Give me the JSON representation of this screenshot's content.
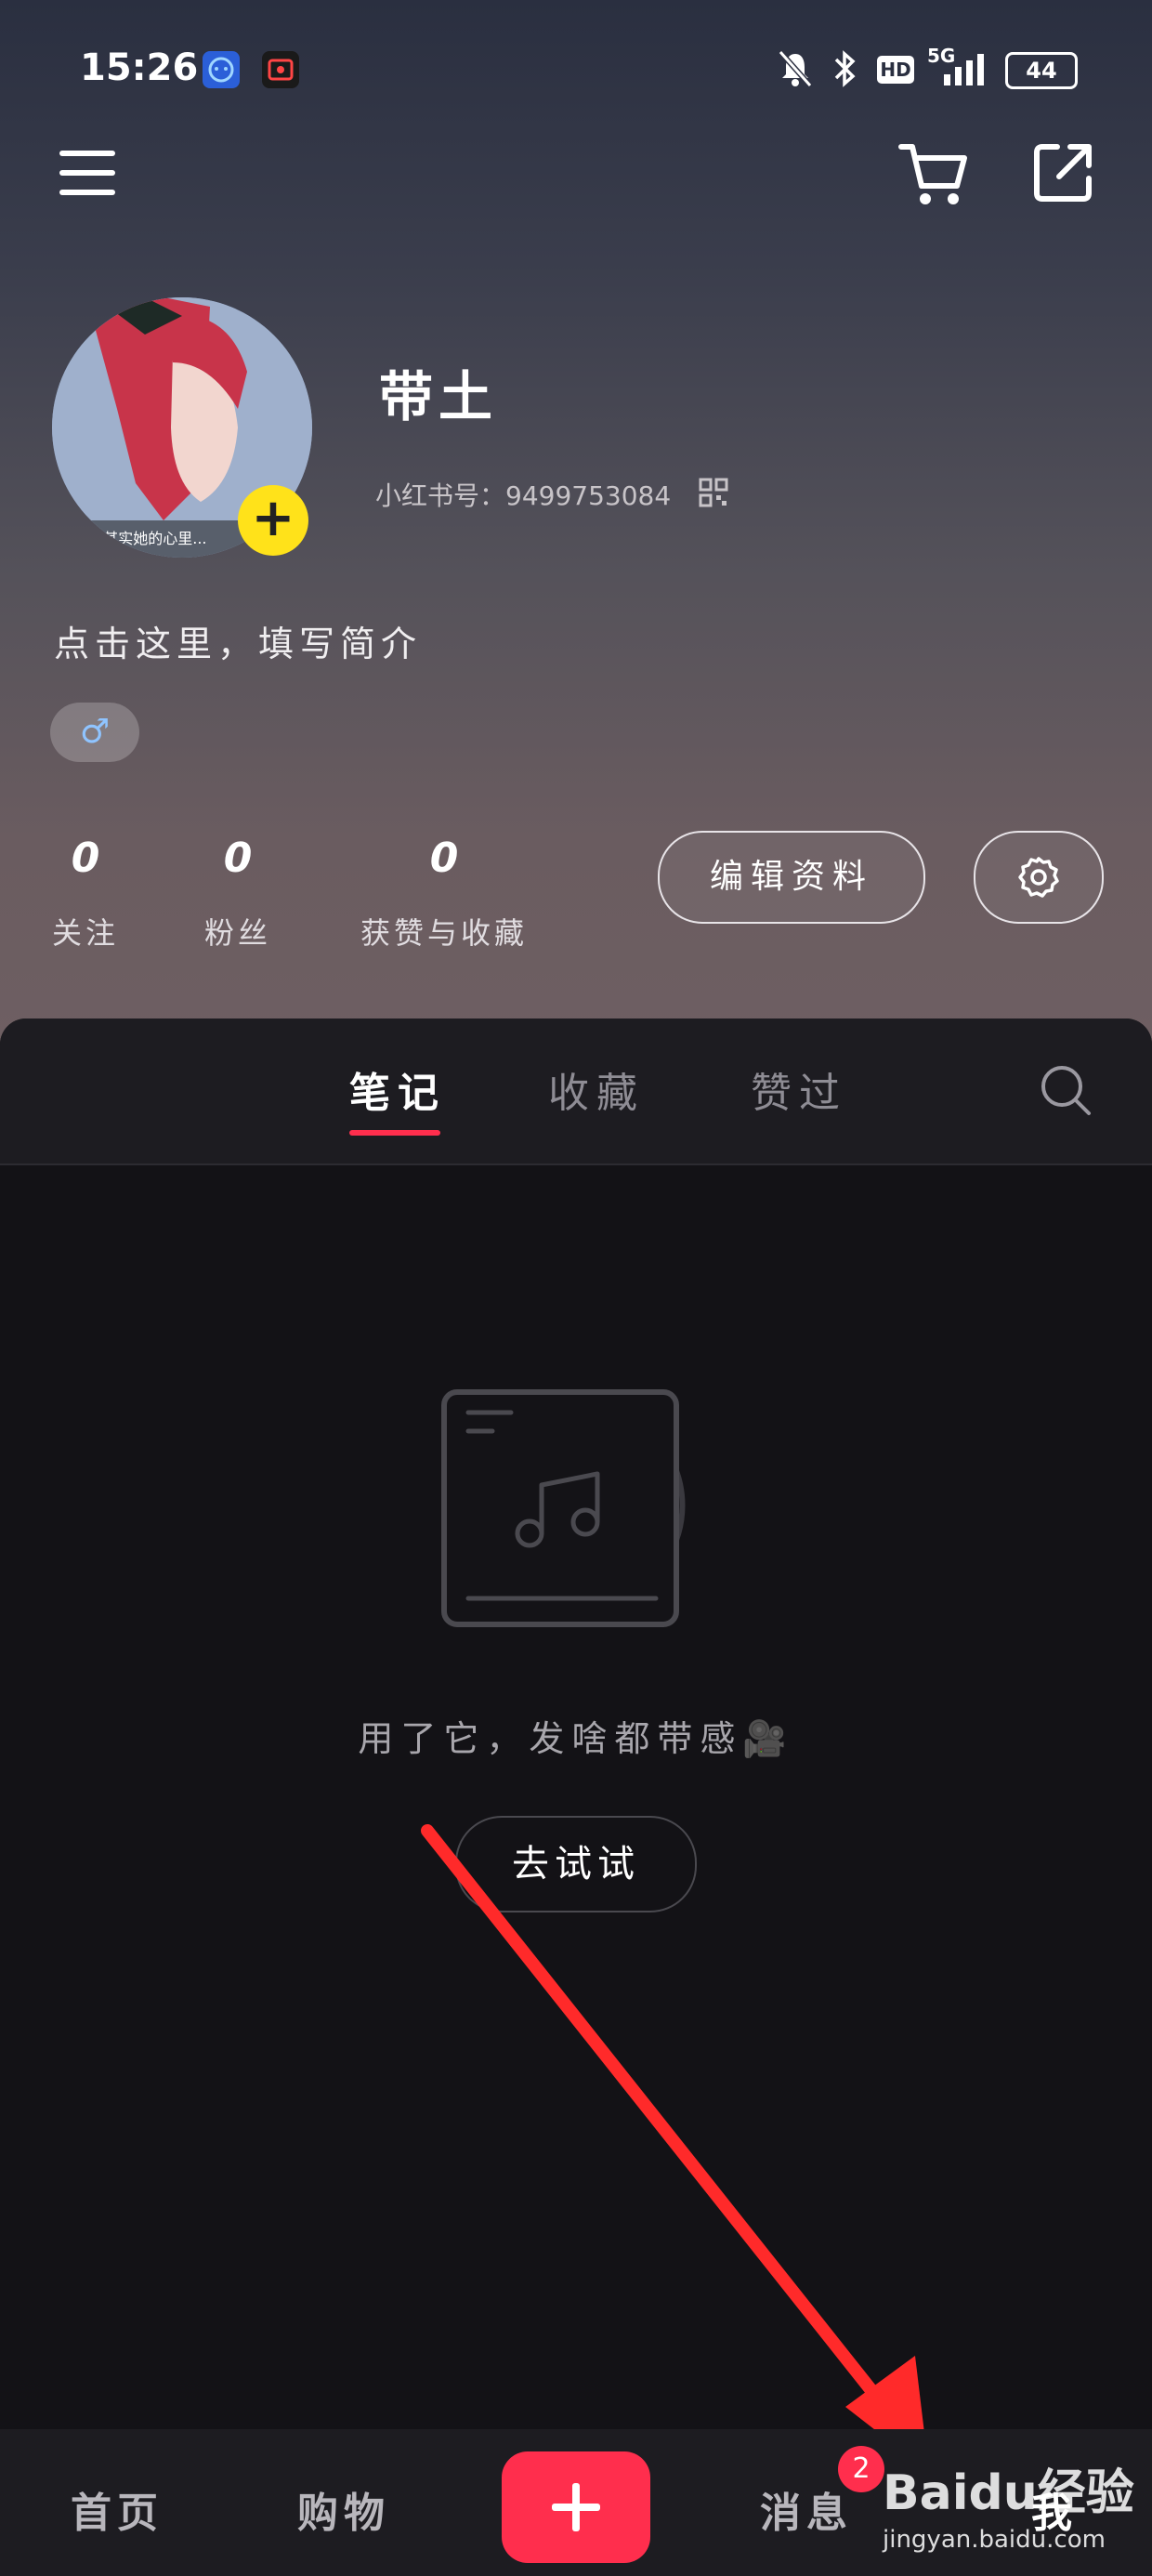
{
  "status_bar": {
    "time": "15:26",
    "network": "5G",
    "hd": "HD",
    "battery": "44"
  },
  "header": {
    "menu_icon": "hamburger-menu-icon",
    "cart_icon": "shopping-cart-icon",
    "share_icon": "share-external-icon"
  },
  "profile": {
    "username": "带土",
    "user_id_label": "小红书号：",
    "user_id": "9499753084",
    "bio_placeholder": "点击这里，填写简介",
    "gender_symbol": "♂",
    "avatar_caption": "...其实她的心里..."
  },
  "stats": [
    {
      "value": "0",
      "label": "关注"
    },
    {
      "value": "0",
      "label": "粉丝"
    },
    {
      "value": "0",
      "label": "获赞与收藏"
    }
  ],
  "actions": {
    "edit_profile": "编辑资料"
  },
  "tabs": [
    {
      "label": "笔记",
      "active": true
    },
    {
      "label": "收藏",
      "active": false
    },
    {
      "label": "赞过",
      "active": false
    }
  ],
  "empty_state": {
    "message": "用了它，发啥都带感🎥",
    "button": "去试试"
  },
  "bottom_nav": {
    "home": "首页",
    "shop": "购物",
    "messages": "消息",
    "me": "我",
    "message_badge": "2"
  },
  "watermark": {
    "brand": "Baidu经验",
    "url": "jingyan.baidu.com"
  },
  "colors": {
    "accent": "#ff2e4d",
    "avatar_badge": "#ffe21a"
  }
}
